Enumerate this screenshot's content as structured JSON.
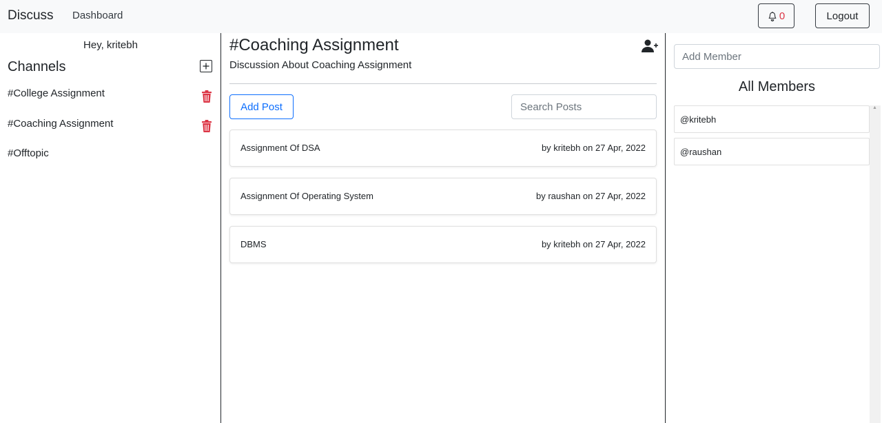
{
  "navbar": {
    "brand": "Discuss",
    "dashboard_link": "Dashboard",
    "notification_count": "0",
    "logout_label": "Logout"
  },
  "sidebar": {
    "greeting": "Hey, kritebh",
    "channels_title": "Channels",
    "channels": [
      {
        "name": "#College Assignment",
        "deletable": true
      },
      {
        "name": "#Coaching Assignment",
        "deletable": true
      },
      {
        "name": "#Offtopic",
        "deletable": false
      }
    ]
  },
  "main": {
    "channel_title": "#Coaching Assignment",
    "channel_description": "Discussion About Coaching Assignment",
    "add_post_label": "Add Post",
    "search_placeholder": "Search Posts",
    "posts": [
      {
        "title": "Assignment Of DSA",
        "meta": "by kritebh on 27 Apr, 2022"
      },
      {
        "title": "Assignment Of Operating System",
        "meta": "by raushan on 27 Apr, 2022"
      },
      {
        "title": "DBMS",
        "meta": "by kritebh on 27 Apr, 2022"
      }
    ]
  },
  "members": {
    "add_member_placeholder": "Add Member",
    "title": "All Members",
    "list": [
      "@kritebh",
      "@raushan"
    ]
  },
  "colors": {
    "primary": "#0d6efd",
    "danger": "#dc3545",
    "navbar_bg": "#f8f9fa"
  },
  "icons": {
    "notification": "bell-icon",
    "add_channel": "plus-square-icon",
    "delete_channel": "trash-icon",
    "add_member": "person-plus-icon"
  }
}
